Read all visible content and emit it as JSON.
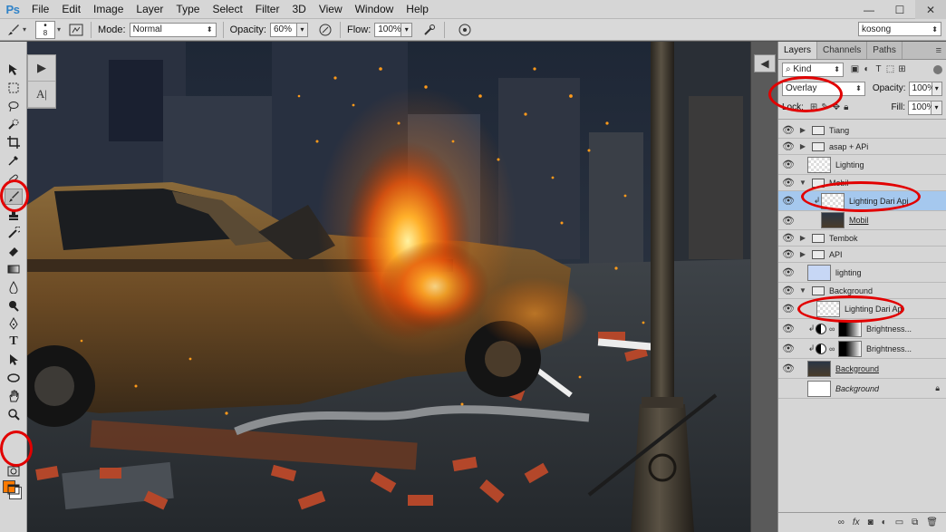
{
  "app": {
    "logo": "Ps"
  },
  "menu": [
    "File",
    "Edit",
    "Image",
    "Layer",
    "Type",
    "Select",
    "Filter",
    "3D",
    "View",
    "Window",
    "Help"
  ],
  "window_controls": {
    "minimize": "—",
    "maximize": "☐",
    "close": "✕"
  },
  "options": {
    "brush_size": "8",
    "mode_label": "Mode:",
    "mode_value": "Normal",
    "opacity_label": "Opacity:",
    "opacity_value": "60%",
    "flow_label": "Flow:",
    "flow_value": "100%",
    "preset_value": "kosong"
  },
  "colors": {
    "foreground": "#ff7a00",
    "background": "#ffffff",
    "annotation": "#e20000",
    "selected_layer": "#a5c8ee"
  },
  "layers_panel": {
    "tabs": [
      "Layers",
      "Channels",
      "Paths"
    ],
    "filter_value": "Kind",
    "blend_mode": "Overlay",
    "opacity_label": "Opacity:",
    "opacity_value": "100%",
    "lock_label": "Lock:",
    "fill_label": "Fill:",
    "fill_value": "100%",
    "layers": [
      {
        "name": "Tiang",
        "type": "group"
      },
      {
        "name": "asap + APi",
        "type": "group"
      },
      {
        "name": "Lighting",
        "type": "pixel"
      },
      {
        "name": "Mobil",
        "type": "group-open"
      },
      {
        "name": "Lighting Dari Api",
        "type": "clipped-pixel",
        "selected": true
      },
      {
        "name": "Mobil",
        "type": "pixel-underlined"
      },
      {
        "name": "Tembok",
        "type": "group"
      },
      {
        "name": "API",
        "type": "group"
      },
      {
        "name": "lighting",
        "type": "pixel-blue"
      },
      {
        "name": "Background",
        "type": "group-open"
      },
      {
        "name": "Lighting Dari Api",
        "type": "pixel"
      },
      {
        "name": "Brightness...",
        "type": "adjustment"
      },
      {
        "name": "Brightness...",
        "type": "adjustment"
      },
      {
        "name": "Background",
        "type": "pixel-underlined"
      },
      {
        "name": "Background",
        "type": "background-locked"
      }
    ]
  }
}
